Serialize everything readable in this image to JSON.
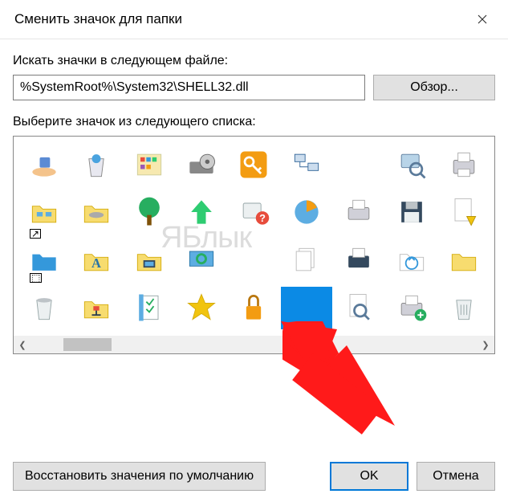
{
  "window": {
    "title": "Сменить значок для папки"
  },
  "search": {
    "label": "Искать значки в следующем файле:",
    "path": "%SystemRoot%\\System32\\SHELL32.dll",
    "browse": "Обзор..."
  },
  "pick": {
    "label": "Выберите значок из следующего списка:"
  },
  "watermark": "ЯБлык",
  "buttons": {
    "restore": "Восстановить значения по умолчанию",
    "ok": "OK",
    "cancel": "Отмена"
  },
  "icons": [
    [
      "hand-share-icon",
      "recycle-bin-full-icon",
      "control-panel-icon",
      "optical-drive-icon",
      "key-orange-icon",
      "network-computers-icon",
      "empty-icon",
      "search-computer-icon",
      "printer-fax-icon",
      "recycle-bin-icon"
    ],
    [
      "network-folder-icon",
      "network-drive-icon",
      "tree-icon",
      "arrow-up-green-icon",
      "help-shield-icon",
      "chart-blue-icon",
      "printer-icon",
      "floppy-disk-icon",
      "document-warning-icon"
    ],
    [
      "blue-folder-icon",
      "font-folder-icon",
      "computer-folder-icon",
      "refresh-monitor-icon",
      "empty-icon",
      "documents-stack-icon",
      "printer-flat-icon",
      "recycle-folder-icon",
      "yellow-folder-icon"
    ],
    [
      "recycle-empty-icon",
      "network-tree-icon",
      "checklist-icon",
      "star-favorite-icon",
      "padlock-icon",
      "selected-blank-icon",
      "search-document-icon",
      "printer-add-icon",
      "recycle-bin-alt-icon",
      "pattern-folder-icon"
    ]
  ]
}
